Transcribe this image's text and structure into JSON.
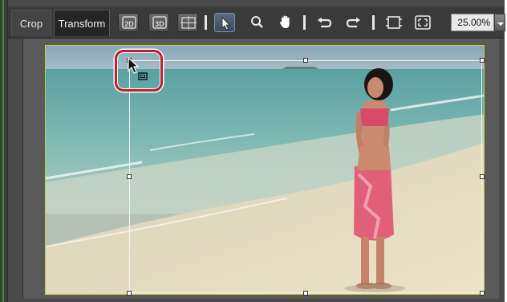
{
  "tabs": [
    {
      "label": "Crop",
      "active": false
    },
    {
      "label": "Transform",
      "active": true
    }
  ],
  "toolbar": {
    "buttons": [
      {
        "name": "2d-mode-button",
        "icon": "2d-icon",
        "active": false
      },
      {
        "name": "3d-mode-button",
        "icon": "3d-icon",
        "active": false
      },
      {
        "name": "grid-toggle-button",
        "icon": "grid-icon",
        "active": false
      },
      {
        "name": "select-tool-button",
        "icon": "arrow-pointer-icon",
        "active": true
      },
      {
        "name": "zoom-tool-button",
        "icon": "magnifier-icon",
        "active": false
      },
      {
        "name": "hand-tool-button",
        "icon": "hand-icon",
        "active": false
      },
      {
        "name": "undo-button",
        "icon": "undo-arrow-icon",
        "active": false
      },
      {
        "name": "redo-button",
        "icon": "redo-arrow-icon",
        "active": false
      },
      {
        "name": "fit-frame-button",
        "icon": "fit-frame-icon",
        "active": false
      },
      {
        "name": "full-view-button",
        "icon": "full-view-icon",
        "active": false
      }
    ],
    "zoom": "25.00%"
  },
  "colors": {
    "highlight": "#b6222a",
    "toolbar_bg": "#3a3a3a",
    "image_border": "#c8cc4a",
    "active_button": "#5a6a80"
  }
}
